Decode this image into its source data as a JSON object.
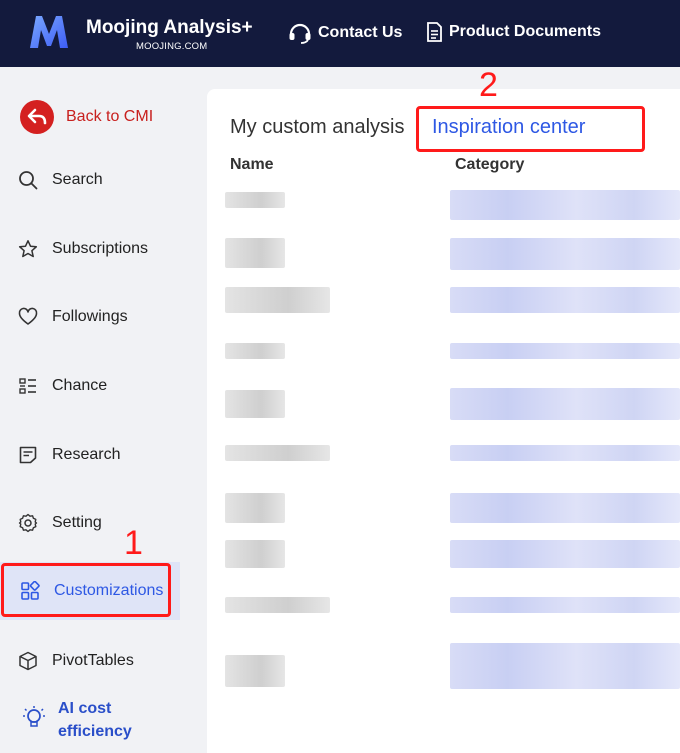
{
  "header": {
    "brand": "Moojing Analysis+",
    "brand_sub": "MOOJING.COM",
    "contact": "Contact Us",
    "docs": "Product Documents"
  },
  "sidebar": {
    "back": "Back to CMI",
    "items": [
      {
        "label": "Search"
      },
      {
        "label": "Subscriptions"
      },
      {
        "label": "Followings"
      },
      {
        "label": "Chance"
      },
      {
        "label": "Research"
      },
      {
        "label": "Setting"
      },
      {
        "label": "Customizations"
      },
      {
        "label": "PivotTables"
      }
    ],
    "ai_line1": "AI cost",
    "ai_line2": "efficiency"
  },
  "main": {
    "tab_my": "My custom analysis",
    "tab_inspiration": "Inspiration center",
    "col_name": "Name",
    "col_category": "Category"
  },
  "annotations": {
    "one": "1",
    "two": "2"
  },
  "colors": {
    "header_bg": "#131a3d",
    "accent": "#2e58e4",
    "back_red": "#d42020",
    "annotation_red": "#ff1a1a"
  }
}
